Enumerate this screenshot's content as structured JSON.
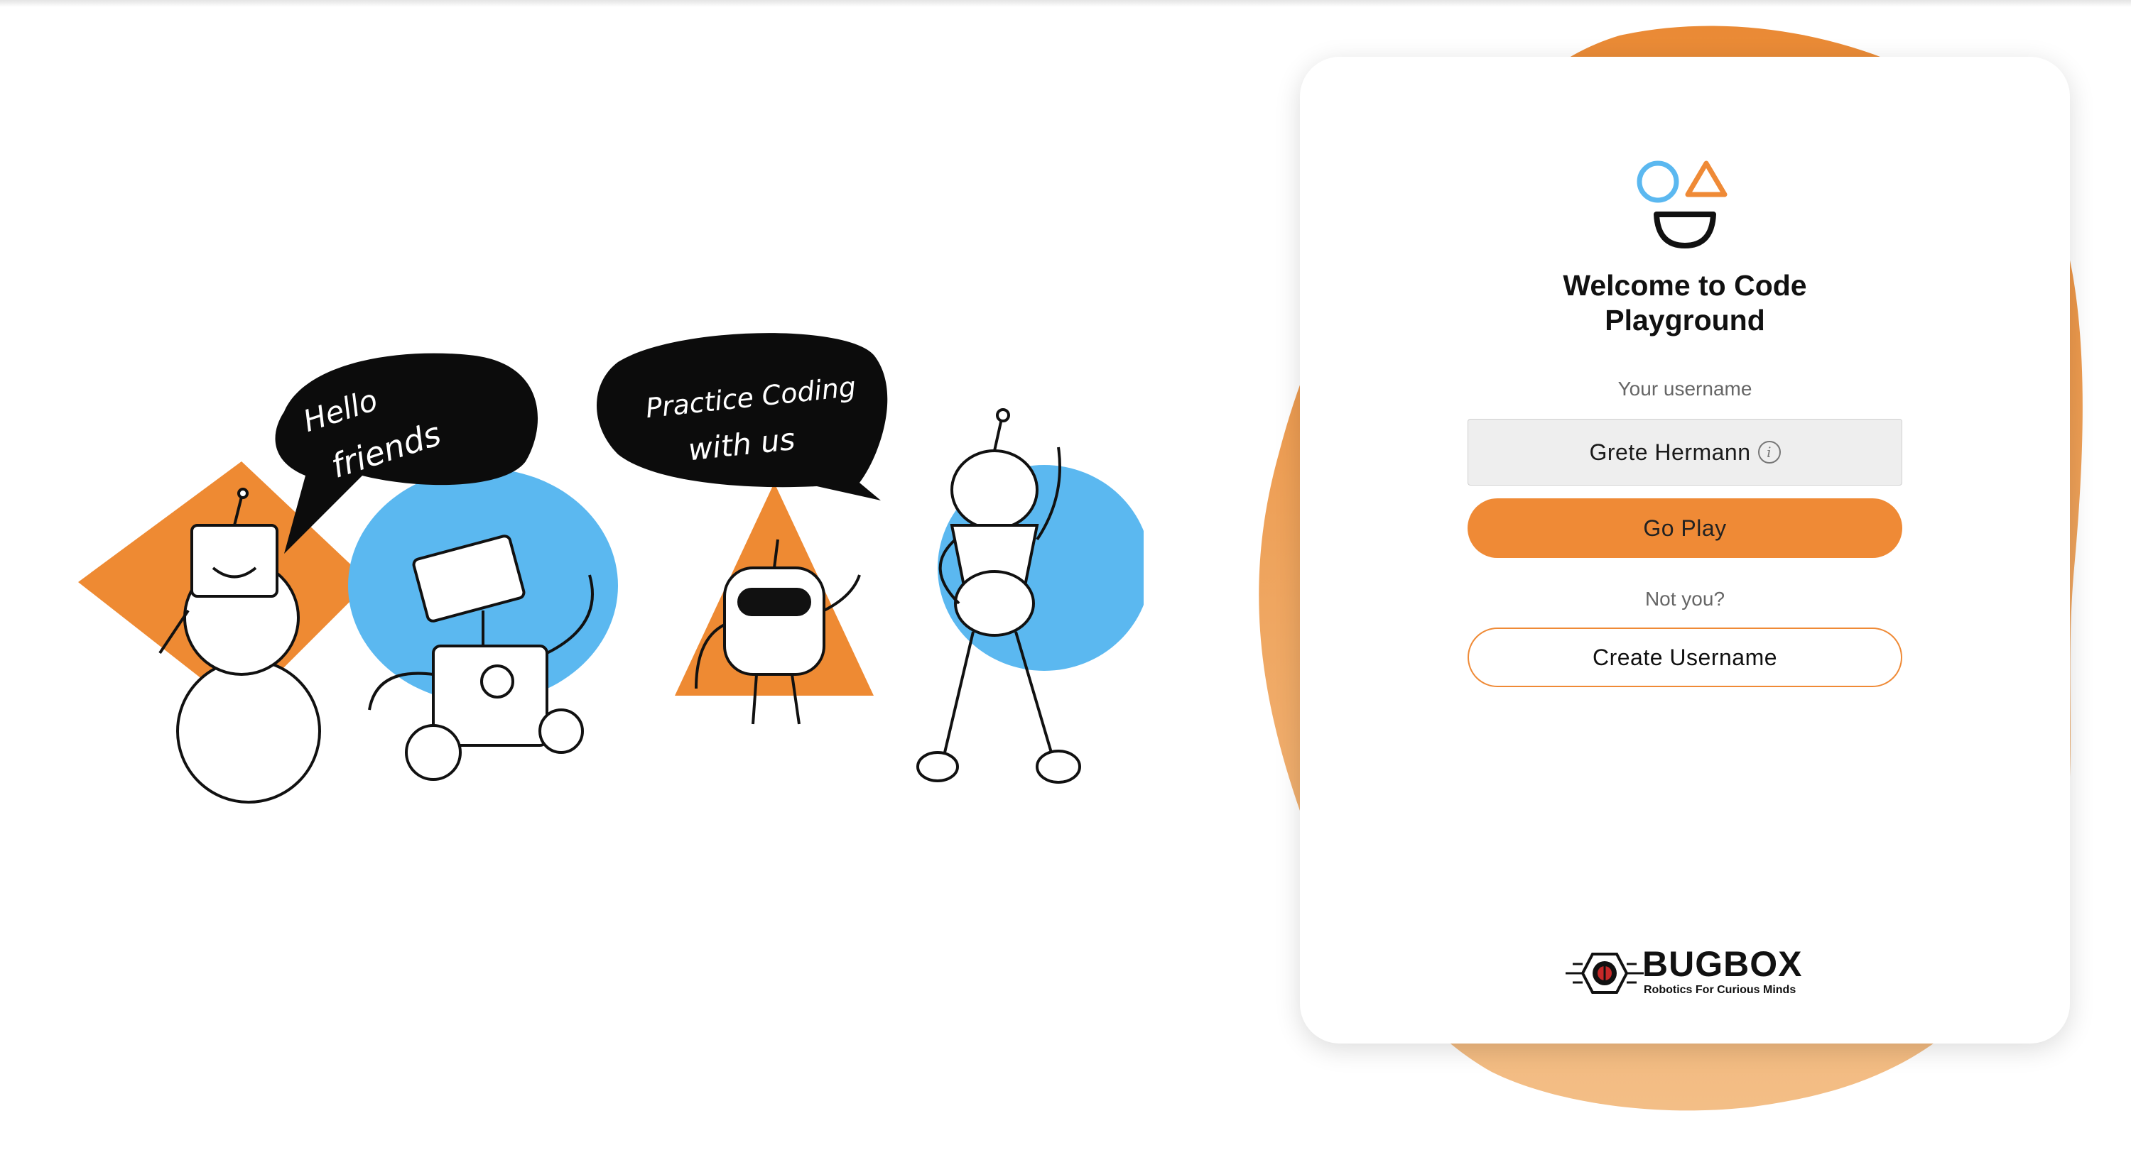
{
  "illustration": {
    "bubble_left": [
      "Hello",
      "friends"
    ],
    "bubble_right": [
      "Practice Coding",
      "with us"
    ]
  },
  "card": {
    "title_line1": "Welcome to Code",
    "title_line2": "Playground",
    "username_label": "Your username",
    "username_value": "Grete Hermann",
    "info_icon_glyph": "i",
    "go_button": "Go Play",
    "not_you": "Not you?",
    "create_button": "Create Username"
  },
  "brand": {
    "name": "BUGBOX",
    "tagline": "Robotics For Curious Minds"
  },
  "colors": {
    "accent_orange": "#ef8a36",
    "accent_blue": "#5bb8f0",
    "blob_orange": "#ea8b3a"
  },
  "icons": {
    "logo": "circle-triangle-smile-logo",
    "info": "info-icon"
  }
}
